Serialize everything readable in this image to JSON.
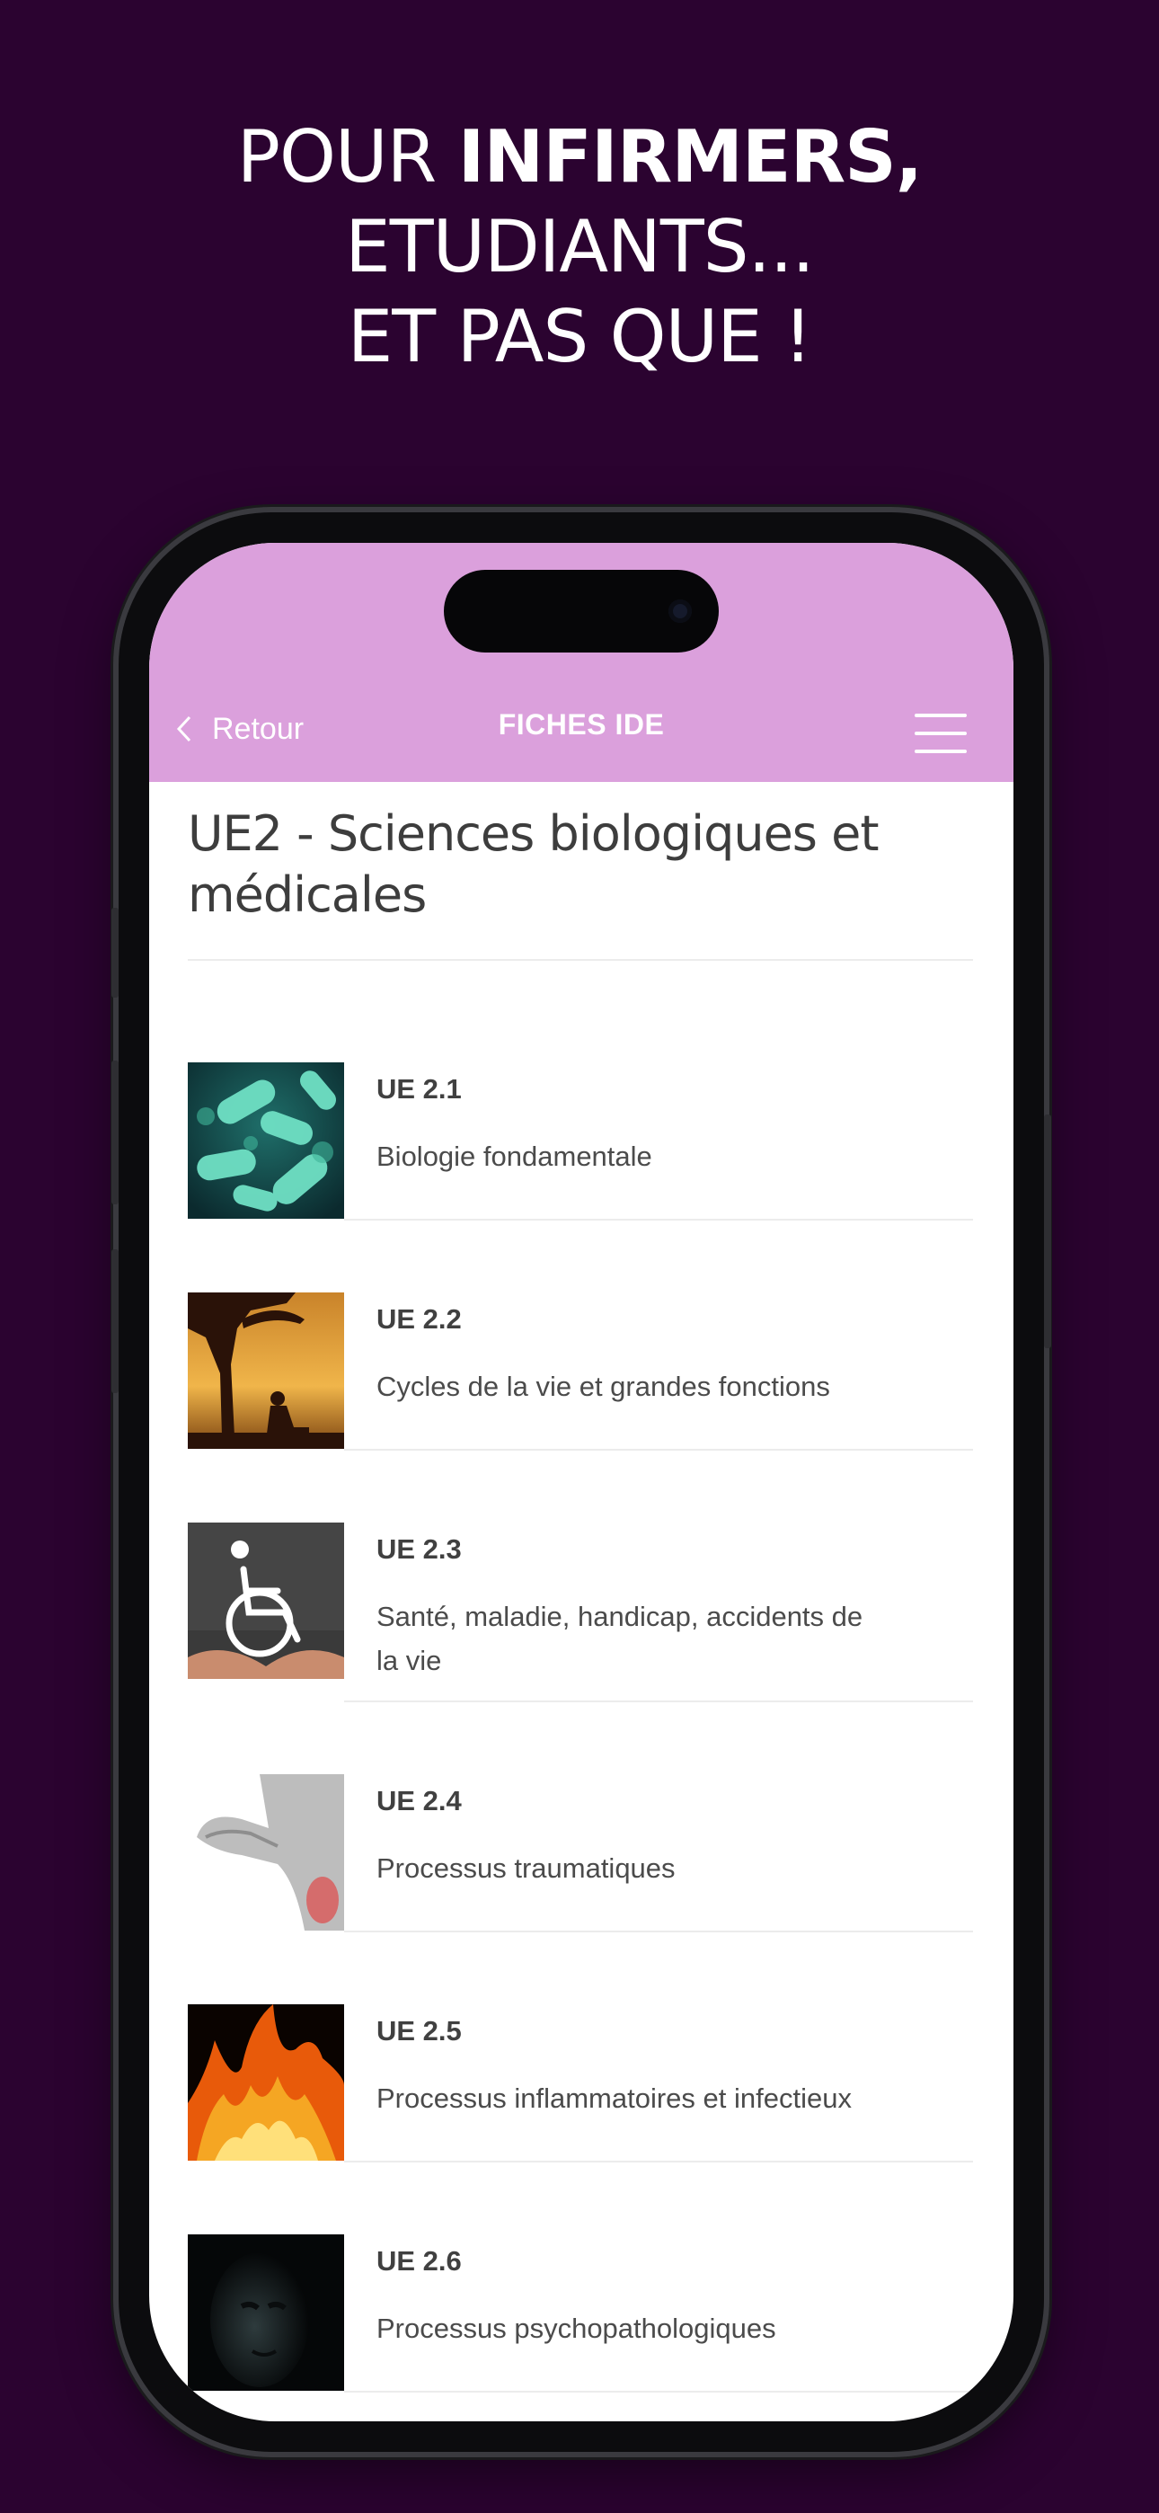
{
  "headline": {
    "line1_prefix": "POUR ",
    "line1_bold": "INFIRMERS,",
    "line2": "ETUDIANTS...",
    "line3": "ET PAS QUE !"
  },
  "navbar": {
    "back_label": "Retour",
    "title": "FICHES IDE"
  },
  "page": {
    "title": "UE2 - Sciences biologiques et médicales"
  },
  "items": [
    {
      "code": "UE 2.1",
      "label": "Biologie fondamentale",
      "image": "bacteria"
    },
    {
      "code": "UE 2.2",
      "label": "Cycles de la vie et grandes fonctions",
      "image": "tree-silhouette"
    },
    {
      "code": "UE 2.3",
      "label": "Santé, maladie, handicap, accidents de la vie",
      "image": "wheelchair"
    },
    {
      "code": "UE 2.4",
      "label": "Processus traumatiques",
      "image": "back-pain"
    },
    {
      "code": "UE 2.5",
      "label": "Processus inflammatoires et infectieux",
      "image": "fire"
    },
    {
      "code": "UE 2.6",
      "label": "Processus psychopathologiques",
      "image": "dark-face"
    }
  ],
  "colors": {
    "background": "#2b0330",
    "topbar": "#dba0dc"
  }
}
